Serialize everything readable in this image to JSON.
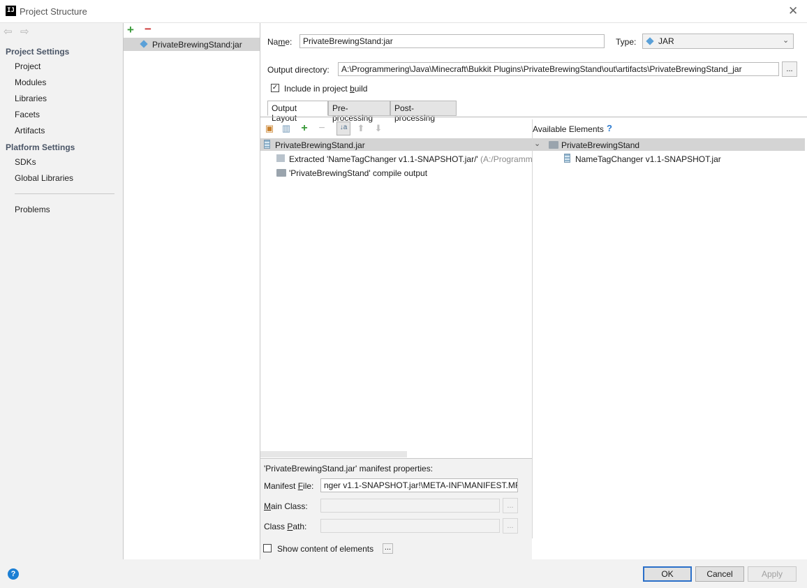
{
  "window": {
    "title": "Project Structure",
    "app_icon_text": "IJ"
  },
  "sidebar": {
    "project_settings_header": "Project Settings",
    "project_items": [
      {
        "label": "Project"
      },
      {
        "label": "Modules"
      },
      {
        "label": "Libraries"
      },
      {
        "label": "Facets"
      },
      {
        "label": "Artifacts"
      }
    ],
    "platform_settings_header": "Platform Settings",
    "platform_items": [
      {
        "label": "SDKs"
      },
      {
        "label": "Global Libraries"
      }
    ],
    "problems": "Problems"
  },
  "artifacts_list": {
    "items": [
      {
        "label": "PrivateBrewingStand:jar"
      }
    ]
  },
  "artifact": {
    "name_label": "Name:",
    "name_value": "PrivateBrewingStand:jar",
    "type_label": "Type:",
    "type_value": "JAR",
    "output_dir_label": "Output directory:",
    "output_dir_value": "A:\\Programmering\\Java\\Minecraft\\Bukkit Plugins\\PrivateBrewingStand\\out\\artifacts\\PrivateBrewingStand_jar",
    "browse_label": "...",
    "include_in_build_label": "Include in project build",
    "include_in_build_checked": true
  },
  "tabs": [
    {
      "label": "Output Layout"
    },
    {
      "label": "Pre-processing"
    },
    {
      "label": "Post-processing"
    }
  ],
  "output_tree": {
    "root": "PrivateBrewingStand.jar",
    "children": [
      {
        "label": "Extracted 'NameTagChanger v1.1-SNAPSHOT.jar/'",
        "detail": "(A:/Programme"
      },
      {
        "label": "'PrivateBrewingStand' compile output",
        "detail": ""
      }
    ]
  },
  "available": {
    "header": "Available Elements",
    "help": "?",
    "root": "PrivateBrewingStand",
    "children": [
      {
        "label": "NameTagChanger v1.1-SNAPSHOT.jar"
      }
    ]
  },
  "manifest": {
    "title": "'PrivateBrewingStand.jar' manifest properties:",
    "file_label_pre": "Manifest ",
    "file_label_ul": "F",
    "file_label_post": "ile:",
    "file_value": "nger v1.1-SNAPSHOT.jar!\\META-INF\\MANIFEST.MF",
    "main_class_label_ul": "M",
    "main_class_label_post": "ain Class:",
    "main_class_value": "",
    "class_path_label_pre": "Class ",
    "class_path_label_ul": "P",
    "class_path_label_post": "ath:",
    "class_path_value": "",
    "dots": "..."
  },
  "show_content": {
    "label": "Show content of elements",
    "checked": false,
    "dots": "..."
  },
  "buttons": {
    "ok": "OK",
    "cancel": "Cancel",
    "apply": "Apply",
    "help": "?"
  },
  "colors": {
    "accent": "#2a6fc9",
    "selection": "#d4d4d4",
    "add": "#3a9a3a",
    "remove": "#cc3333",
    "help": "#1c7fd4"
  }
}
